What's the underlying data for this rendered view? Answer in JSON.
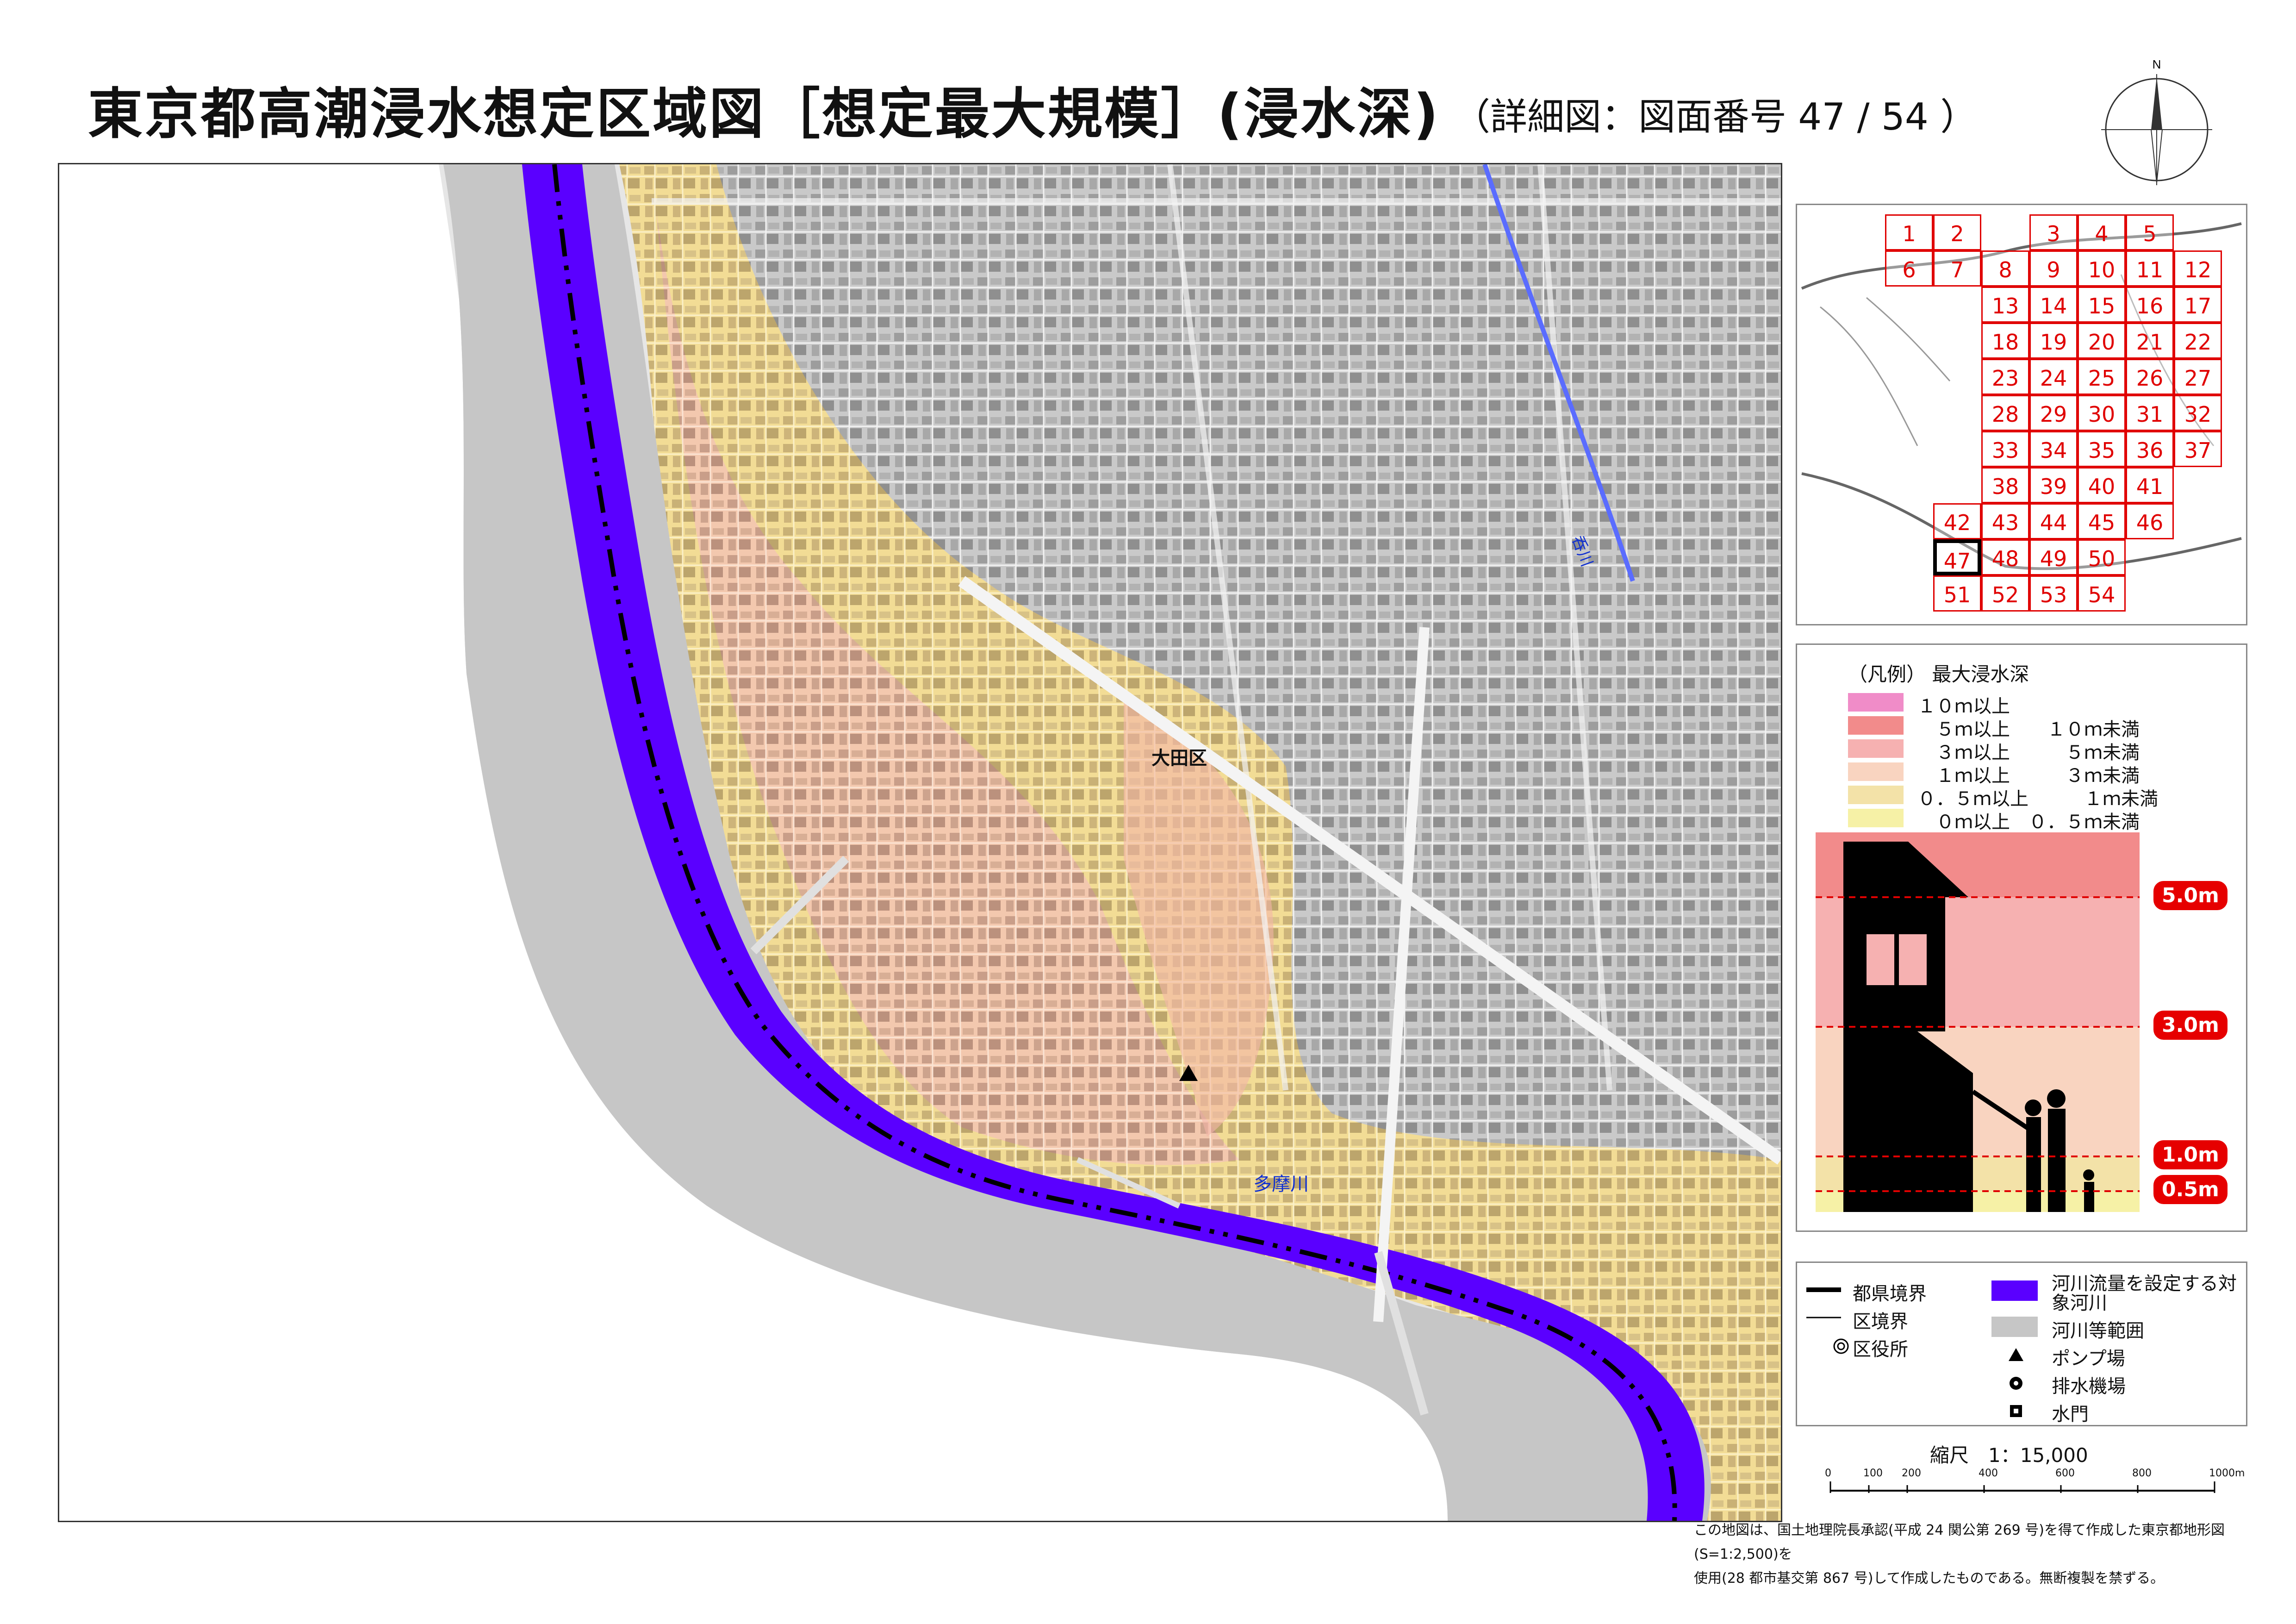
{
  "header": {
    "title": "東京都高潮浸水想定区域図［想定最大規模］(浸水深)",
    "subtitle": "（詳細図：図面番号 47 / 54 ）",
    "north_label": "N"
  },
  "map": {
    "labels": {
      "ward": "大田区",
      "river_main": "多摩川",
      "river_small": "呑川"
    },
    "colors": {
      "river": "#5a00ff",
      "river_area": "#c8c8c8",
      "depth_0_05": "#f7f0a8",
      "depth_05_1": "#f2d98c",
      "depth_1_3": "#f6c9a8",
      "depth_3_5": "#f4a8a8",
      "urban": "#bfbfbf"
    }
  },
  "index_map": {
    "rows": [
      [
        "1",
        "2",
        "",
        "3",
        "4",
        "5"
      ],
      [
        "6",
        "7",
        "8",
        "9",
        "10",
        "11",
        "12"
      ],
      [
        "13",
        "14",
        "15",
        "16",
        "17"
      ],
      [
        "18",
        "19",
        "20",
        "21",
        "22"
      ],
      [
        "23",
        "24",
        "25",
        "26",
        "27"
      ],
      [
        "28",
        "29",
        "30",
        "31",
        "32"
      ],
      [
        "33",
        "34",
        "35",
        "36",
        "37"
      ],
      [
        "38",
        "39",
        "40",
        "41"
      ],
      [
        "42",
        "43",
        "44",
        "45",
        "46"
      ],
      [
        "47",
        "48",
        "49",
        "50"
      ],
      [
        "51",
        "52",
        "53",
        "54"
      ]
    ],
    "current": "47",
    "grid_color": "#e00000"
  },
  "legend": {
    "title": "（凡例） 最大浸水深",
    "items": [
      {
        "label": "１０ｍ以上",
        "color": "#f08cc8"
      },
      {
        "label": "　５ｍ以上　　１０ｍ未満",
        "color": "#f28b8b"
      },
      {
        "label": "　３ｍ以上　　　５ｍ未満",
        "color": "#f6b1b1"
      },
      {
        "label": "　１ｍ以上　　　３ｍ未満",
        "color": "#f9d4c0"
      },
      {
        "label": "０．５ｍ以上　　　１ｍ未満",
        "color": "#f3e2a8"
      },
      {
        "label": "　０ｍ以上　０．５ｍ未満",
        "color": "#f6f1a6"
      }
    ],
    "depth_markers": [
      "5.0m",
      "3.0m",
      "1.0m",
      "0.5m"
    ]
  },
  "symbols": {
    "pref_border": "都県境界",
    "ward_border": "区境界",
    "ward_office": "区役所",
    "target_river": "河川流量を設定する対象河川",
    "river_range": "河川等範囲",
    "pump": "ポンプ場",
    "drain": "排水機場",
    "sluice": "水門"
  },
  "scale": {
    "label": "縮尺　1：15,000",
    "ticks": [
      "0",
      "100",
      "200",
      "400",
      "600",
      "800",
      "1000m"
    ]
  },
  "credit": {
    "line1": "この地図は、国土地理院長承認(平成 24 関公第 269 号)を得て作成した東京都地形図(S=1:2,500)を",
    "line2": "使用(28 都市基交第 867 号)して作成したものである。無断複製を禁ずる。"
  }
}
